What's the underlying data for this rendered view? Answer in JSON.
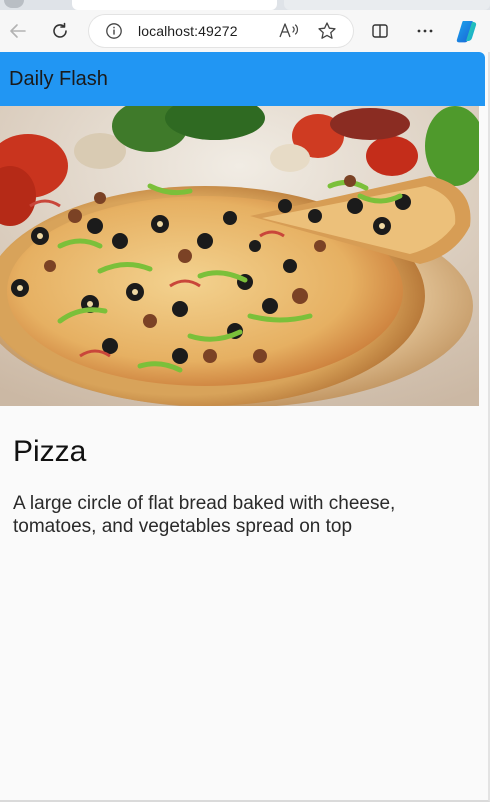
{
  "browser": {
    "url": "localhost:49272",
    "colors": {
      "chrome": "#f7f7f7",
      "omnibox": "#ffffff"
    },
    "icons": {
      "back": "back-arrow-icon",
      "refresh": "refresh-icon",
      "info": "info-icon",
      "read_aloud": "read-aloud-icon",
      "favorite": "star-icon",
      "split": "split-screen-icon",
      "more": "more-icon",
      "copilot": "copilot-icon"
    }
  },
  "app": {
    "title": "Daily Flash",
    "accent": "#2196f3",
    "item": {
      "name": "Pizza",
      "description": "A large circle of flat bread baked with cheese, tomatoes, and vegetables spread on top",
      "image_alt": "pizza-photo"
    }
  }
}
